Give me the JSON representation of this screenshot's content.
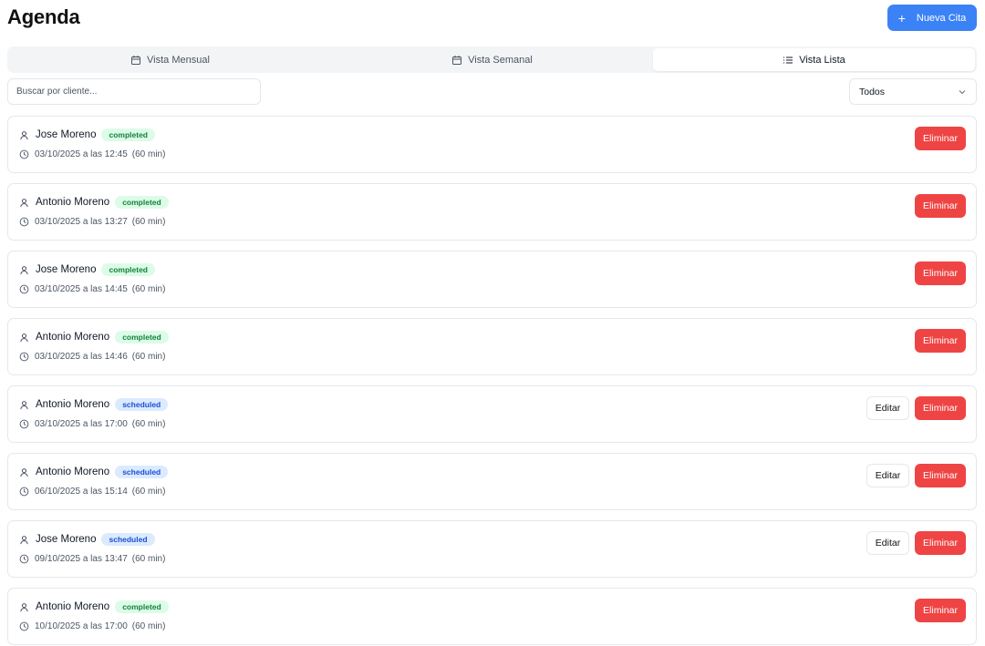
{
  "header": {
    "title": "Agenda",
    "new_button": "Nueva Cita",
    "new_icon": "plus-icon"
  },
  "tabs": [
    {
      "label": "Vista Mensual",
      "icon": "calendar-icon",
      "active": false
    },
    {
      "label": "Vista Semanal",
      "icon": "calendar-icon",
      "active": false
    },
    {
      "label": "Vista Lista",
      "icon": "list-icon",
      "active": true
    }
  ],
  "filters": {
    "search_placeholder": "Buscar por cliente...",
    "search_value": "",
    "status_selected": "Todos"
  },
  "colors": {
    "primary": "#3b82f6",
    "danger": "#ef4444",
    "completed_bg": "#dcfce7",
    "completed_text": "#15803d",
    "scheduled_bg": "#dbeafe",
    "scheduled_text": "#1d4ed8"
  },
  "labels": {
    "edit": "Editar",
    "delete": "Eliminar"
  },
  "appointments": [
    {
      "client": "Jose Moreno",
      "status": "completed",
      "datetime": "03/10/2025 a las 12:45",
      "duration": "(60 min)",
      "editable": false
    },
    {
      "client": "Antonio Moreno",
      "status": "completed",
      "datetime": "03/10/2025 a las 13:27",
      "duration": "(60 min)",
      "editable": false
    },
    {
      "client": "Jose Moreno",
      "status": "completed",
      "datetime": "03/10/2025 a las 14:45",
      "duration": "(60 min)",
      "editable": false
    },
    {
      "client": "Antonio Moreno",
      "status": "completed",
      "datetime": "03/10/2025 a las 14:46",
      "duration": "(60 min)",
      "editable": false
    },
    {
      "client": "Antonio Moreno",
      "status": "scheduled",
      "datetime": "03/10/2025 a las 17:00",
      "duration": "(60 min)",
      "editable": true
    },
    {
      "client": "Antonio Moreno",
      "status": "scheduled",
      "datetime": "06/10/2025 a las 15:14",
      "duration": "(60 min)",
      "editable": true
    },
    {
      "client": "Jose Moreno",
      "status": "scheduled",
      "datetime": "09/10/2025 a las 13:47",
      "duration": "(60 min)",
      "editable": true
    },
    {
      "client": "Antonio Moreno",
      "status": "completed",
      "datetime": "10/10/2025 a las 17:00",
      "duration": "(60 min)",
      "editable": false
    }
  ]
}
